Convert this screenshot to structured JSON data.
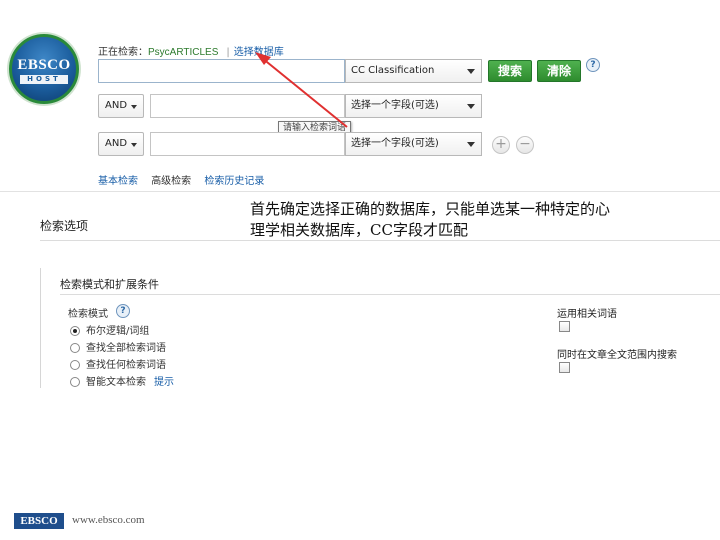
{
  "logo": {
    "text": "EBSCO",
    "band": "HOST"
  },
  "header": {
    "searching_label": "正在检索：",
    "database": "PsycARTICLES",
    "separator": "|",
    "choose_db_link": "选择数据库"
  },
  "search_rows": [
    {
      "bool": "",
      "field": "CC Classification"
    },
    {
      "bool": "AND",
      "field": "选择一个字段(可选)"
    },
    {
      "bool": "AND",
      "field": "选择一个字段(可选)"
    }
  ],
  "buttons": {
    "search": "搜索",
    "clear": "清除",
    "help": "?",
    "add": "+",
    "remove": "−"
  },
  "tooltip": "请输入检索词语",
  "links": [
    "基本检索",
    "高级检索",
    "检索历史记录"
  ],
  "options": {
    "title": "检索选项",
    "panel_title": "检索模式和扩展条件",
    "mode_label": "检索模式",
    "modes": [
      {
        "label": "布尔逻辑/词组",
        "selected": true
      },
      {
        "label": "查找全部检索词语",
        "selected": false
      },
      {
        "label": "查找任何检索词语",
        "selected": false
      },
      {
        "label": "智能文本检索",
        "selected": false,
        "hint": "提示"
      }
    ],
    "expanders": [
      {
        "label": "运用相关词语",
        "checked": false
      },
      {
        "label": "同时在文章全文范围内搜索",
        "checked": false
      }
    ]
  },
  "annotation": "首先确定选择正确的数据库，只能单选某一种特定的心理学相关数据库，CC字段才匹配",
  "footer": {
    "logo": "EBSCO",
    "url": "www.ebsco.com"
  },
  "colors": {
    "green": "#2e8c2e",
    "link": "#1a5fa8",
    "arrow": "#e03030"
  }
}
